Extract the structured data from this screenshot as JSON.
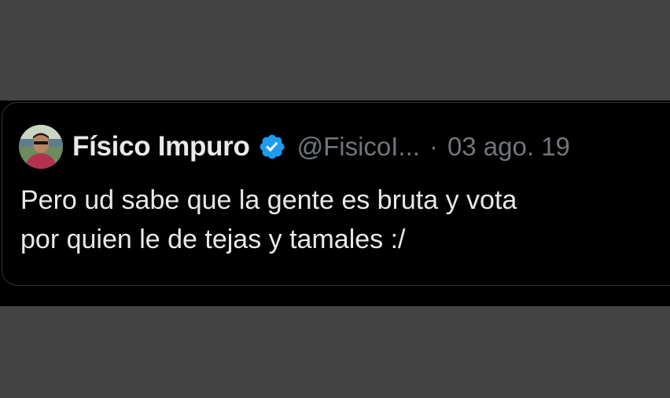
{
  "tweet": {
    "author": {
      "display_name": "Físico Impuro",
      "handle": "@FisicoI...",
      "verified_icon": "verified-badge-icon",
      "avatar_icon": "avatar"
    },
    "separator": "·",
    "date": "03 ago. 19",
    "text_line1": "Pero ud sabe que la gente es bruta y vota",
    "text_line2": "por quien le de tejas y tamales :/"
  },
  "colors": {
    "page_background": "#434343",
    "card_background": "#000000",
    "primary_text": "#e7e9ea",
    "secondary_text": "#71767b",
    "verified_blue": "#1d9bf0",
    "card_border": "#2f3336"
  }
}
